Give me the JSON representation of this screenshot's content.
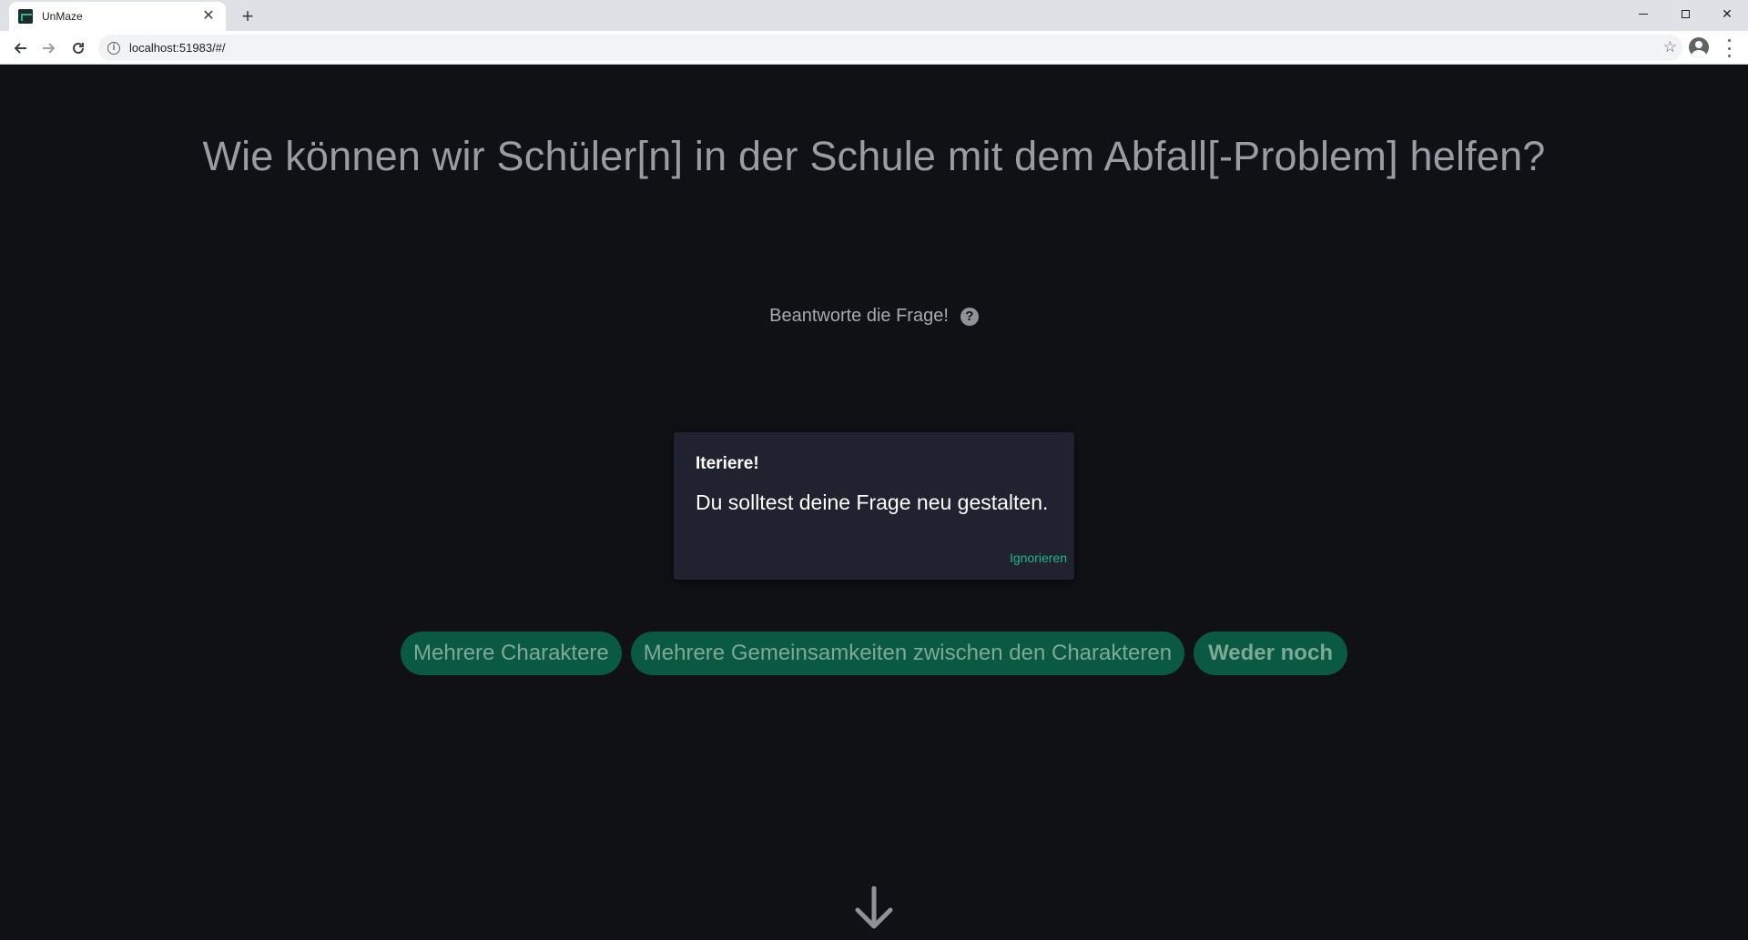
{
  "browser": {
    "tab_title": "UnMaze",
    "tab_close": "✕",
    "new_tab": "+",
    "url": "localhost:51983/#/",
    "window_close": "✕"
  },
  "page": {
    "question": "Wie können wir Schüler[n] in der Schule mit dem Abfall[-Problem] helfen?",
    "prompt": "Beantworte die Frage!",
    "help_symbol": "?",
    "toast": {
      "title": "Iteriere!",
      "message": "Du solltest deine Frage neu gestalten.",
      "action": "Ignorieren"
    },
    "choices": [
      "Mehrere Charaktere",
      "Mehrere Gemeinsamkeiten zwischen den Charakteren",
      "Weder noch"
    ]
  },
  "colors": {
    "background": "#0f1115",
    "accent": "#20b68a",
    "chip": "#0a5a43"
  }
}
